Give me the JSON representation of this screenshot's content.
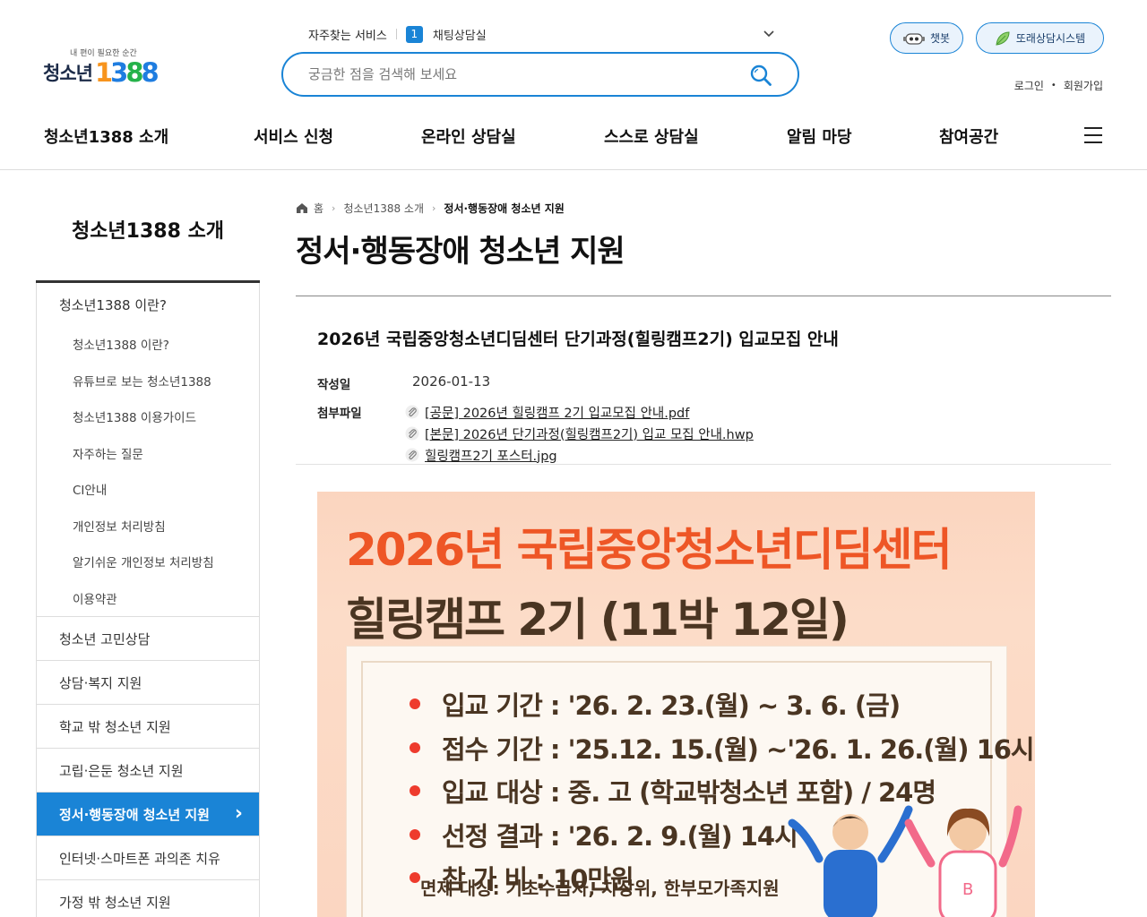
{
  "logo": {
    "tagline": "내 편이 필요한 순간",
    "name": "청소년",
    "number": [
      "1",
      "3",
      "8",
      "8"
    ]
  },
  "quick": {
    "label": "자주찾는 서비스",
    "index": "1",
    "item": "채팅상담실"
  },
  "search": {
    "placeholder": "궁금한 점을 검색해 보세요"
  },
  "top_links": {
    "chatbot": "챗봇",
    "peer": "또래상담시스템",
    "login": "로그인",
    "dot": "•",
    "join": "회원가입"
  },
  "gnb": [
    "청소년1388 소개",
    "서비스 신청",
    "온라인 상담실",
    "스스로 상담실",
    "알림 마당",
    "참여공간"
  ],
  "side": {
    "title": "청소년1388 소개",
    "group1": {
      "label": "청소년1388 이란?",
      "subs": [
        "청소년1388 이란?",
        "유튜브로 보는 청소년1388",
        "청소년1388 이용가이드",
        "자주하는 질문",
        "CI안내",
        "개인정보 처리방침",
        "알기쉬운 개인정보 처리방침",
        "이용약관"
      ]
    },
    "items": [
      "청소년 고민상담",
      "상담·복지 지원",
      "학교 밖 청소년 지원",
      "고립·은둔 청소년 지원",
      "정서·행동장애 청소년 지원",
      "인터넷·스마트폰 과의존 치유",
      "가정 밖 청소년 지원"
    ],
    "active_arrow": "›"
  },
  "breadcrumb": {
    "home": "홈",
    "arrow": "›",
    "level1": "청소년1388 소개",
    "current": "정서·행동장애 청소년 지원"
  },
  "page_title": "정서·행동장애 청소년 지원",
  "post": {
    "title": "2026년 국립중앙청소년디딤센터 단기과정(힐링캠프2기) 입교모집 안내",
    "date_label": "작성일",
    "date": "2026-01-13",
    "files_label": "첨부파일",
    "files": [
      "[공문] 2026년 힐링캠프 2기 입교모집 안내.pdf",
      "[본문] 2026년 단기과정(힐링캠프2기) 입교 모집 안내.hwp",
      "힐링캠프2기 포스터.jpg"
    ]
  },
  "poster": {
    "headline": "2026년  국립중앙청소년디딤센터",
    "subheadline": "힐링캠프 2기 (11박 12일)",
    "items": [
      "입교 기간 : '26. 2. 23.(월) ~ 3. 6. (금)",
      "접수 기간 : '25.12. 15.(월) ~'26. 1. 26.(월) 16시",
      "입교  대상 : 중. 고 (학교밖청소년 포함)  / 24명",
      "선정  결과 : '26.  2. 9.(월) 14시",
      "참    가  비 : 10만원"
    ],
    "note": "면제 대상: 기초수급자, 차상위, 한부모가족지원"
  },
  "colors": {
    "accent": "#1a84d6",
    "poster_red": "#ee5626",
    "poster_brown": "#4a3522"
  }
}
